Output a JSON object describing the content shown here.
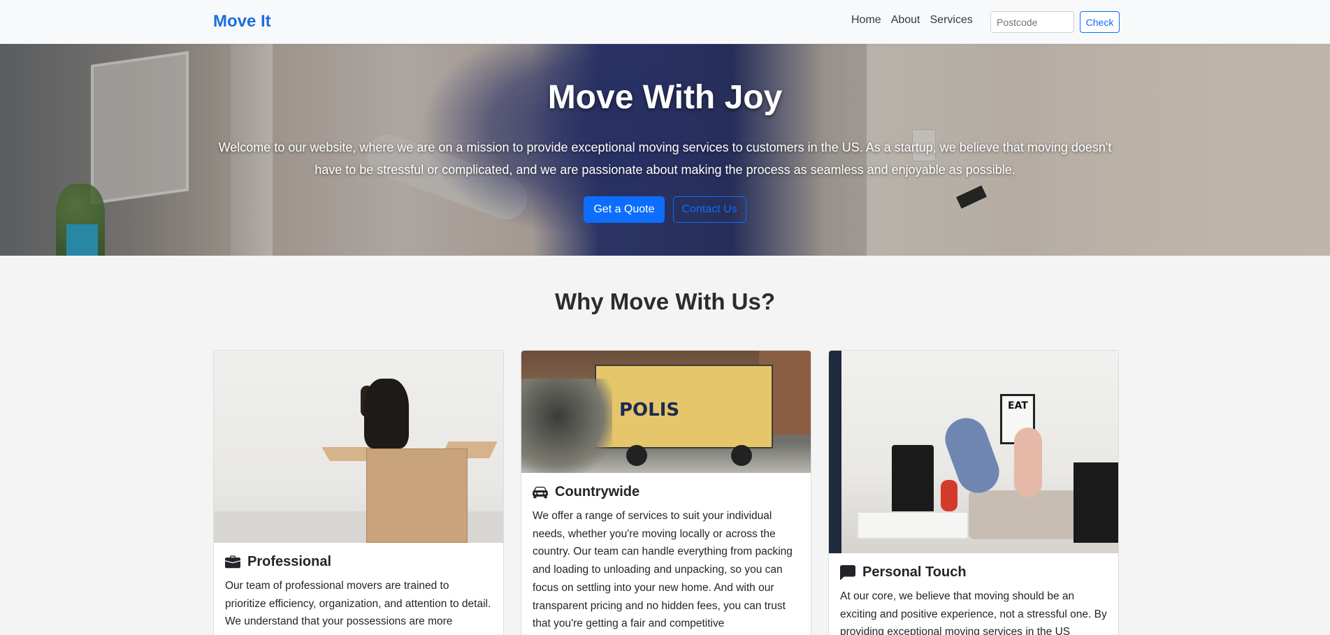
{
  "navbar": {
    "brand": "Move It",
    "links": [
      "Home",
      "About",
      "Services"
    ],
    "postcode_placeholder": "Postcode",
    "check_label": "Check"
  },
  "hero": {
    "title": "Move With Joy",
    "text": "Welcome to our website, where we are on a mission to provide exceptional moving services to customers in the US. As a startup, we believe that moving doesn't have to be stressful or complicated, and we are passionate about making the process as seamless and enjoyable as possible.",
    "primary_button": "Get a Quote",
    "secondary_button": "Contact Us"
  },
  "section": {
    "title": "Why Move With Us?"
  },
  "cards": [
    {
      "icon": "briefcase-icon",
      "title": "Professional",
      "text": "Our team of professional movers are trained to prioritize efficiency, organization, and attention to detail. We understand that your possessions are more"
    },
    {
      "icon": "car-icon",
      "title": "Countrywide",
      "text": "We offer a range of services to suit your individual needs, whether you're moving locally or across the country. Our team can handle everything from packing and loading to unloading and unpacking, so you can focus on settling into your new home. And with our transparent pricing and no hidden fees, you can trust that you're getting a fair and competitive"
    },
    {
      "icon": "chat-icon",
      "title": "Personal Touch",
      "text": "At our core, we believe that moving should be an exciting and positive experience, not a stressful one. By providing exceptional moving services in the US"
    }
  ],
  "colors": {
    "brand": "#1a6fe0",
    "primary": "#0d6efd",
    "background": "#f4f4f4"
  }
}
